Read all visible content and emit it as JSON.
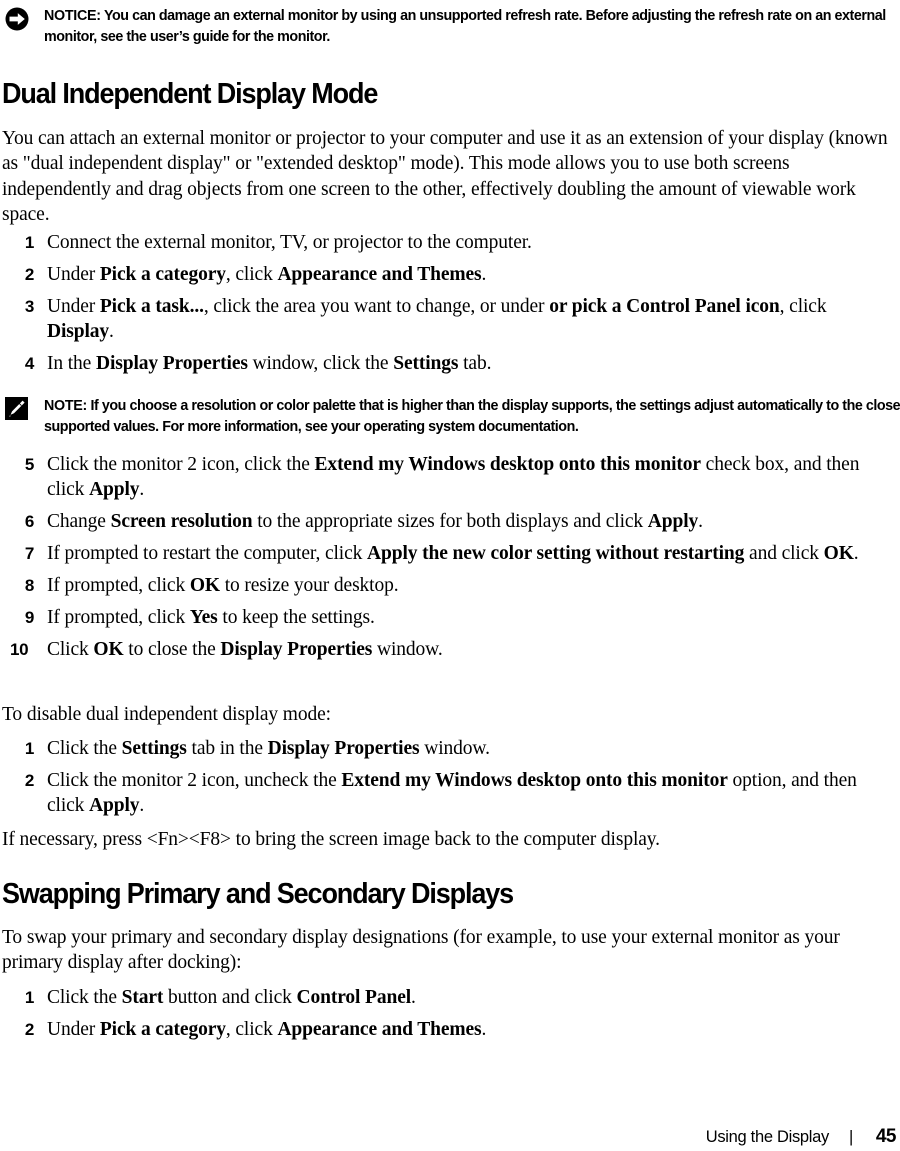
{
  "document": {
    "footer": {
      "title": "Using the Display",
      "separator": "|",
      "page_number": "45"
    }
  },
  "notice_callout": {
    "icon": "notice-arrow-icon",
    "label": "NOTICE:",
    "text": " You can damage an external monitor by using an unsupported refresh rate. Before adjusting the refresh rate on an external monitor, see the user’s guide for the monitor."
  },
  "note_callout": {
    "icon": "note-pencil-icon",
    "label": "NOTE:",
    "text": " If you choose a resolution or color palette that is higher than the display supports, the settings adjust automatically to the closest supported values. For more information, see your operating system documentation."
  },
  "section_dual": {
    "heading": "Dual Independent Display Mode",
    "intro": "You can attach an external monitor or projector to your computer and use it as an extension of your display (known as \"dual independent display\" or \"extended desktop\" mode). This mode allows you to use both screens independently and drag objects from one screen to the other, effectively doubling the amount of viewable work space.",
    "steps_a": [
      {
        "num": "1",
        "html": "Connect the external monitor, TV, or projector to the computer."
      },
      {
        "num": "2",
        "html": "Under <b>Pick a category</b>, click <b>Appearance and Themes</b>."
      },
      {
        "num": "3",
        "html": "Under <b>Pick a task...</b>, click the area you want to change, or under <b>or pick a Control Panel icon</b>, click <b>Display</b>."
      },
      {
        "num": "4",
        "html": "In the <b>Display Properties</b> window, click the <b>Settings</b> tab."
      }
    ],
    "steps_b": [
      {
        "num": "5",
        "html": "Click the monitor 2 icon, click the <b>Extend my Windows desktop onto this monitor</b> check box, and then click <b>Apply</b>."
      },
      {
        "num": "6",
        "html": "Change <b>Screen resolution</b> to the appropriate sizes for both displays and click <b>Apply</b>."
      },
      {
        "num": "7",
        "html": "If prompted to restart the computer, click <b>Apply the new color setting without restarting</b> and click <b>OK</b>."
      },
      {
        "num": "8",
        "html": "If prompted, click <b>OK</b> to resize your desktop."
      },
      {
        "num": "9",
        "html": "If prompted, click <b>Yes</b> to keep the settings."
      },
      {
        "num": "10",
        "html": "Click <b>OK</b> to close the <b>Display Properties</b> window."
      }
    ],
    "disable_intro": "To disable dual independent display mode:",
    "steps_disable": [
      {
        "num": "1",
        "html": "Click the <b>Settings</b> tab in the <b>Display Properties</b> window."
      },
      {
        "num": "2",
        "html": "Click the monitor 2 icon, uncheck the <b>Extend my Windows desktop onto this monitor</b> option, and then click <b>Apply</b>."
      }
    ],
    "outro": "If necessary, press &lt;Fn&gt;&lt;F8&gt; to bring the screen image back to the computer display."
  },
  "section_swapping": {
    "heading": "Swapping Primary and Secondary Displays",
    "intro": "To swap your primary and secondary display designations (for example, to use your external monitor as your primary display after docking):",
    "steps": [
      {
        "num": "1",
        "html": "Click the <b>Start</b> button and click <b>Control Panel</b>."
      },
      {
        "num": "2",
        "html": "Under <b>Pick a category</b>, click <b>Appearance and Themes</b>."
      }
    ]
  }
}
